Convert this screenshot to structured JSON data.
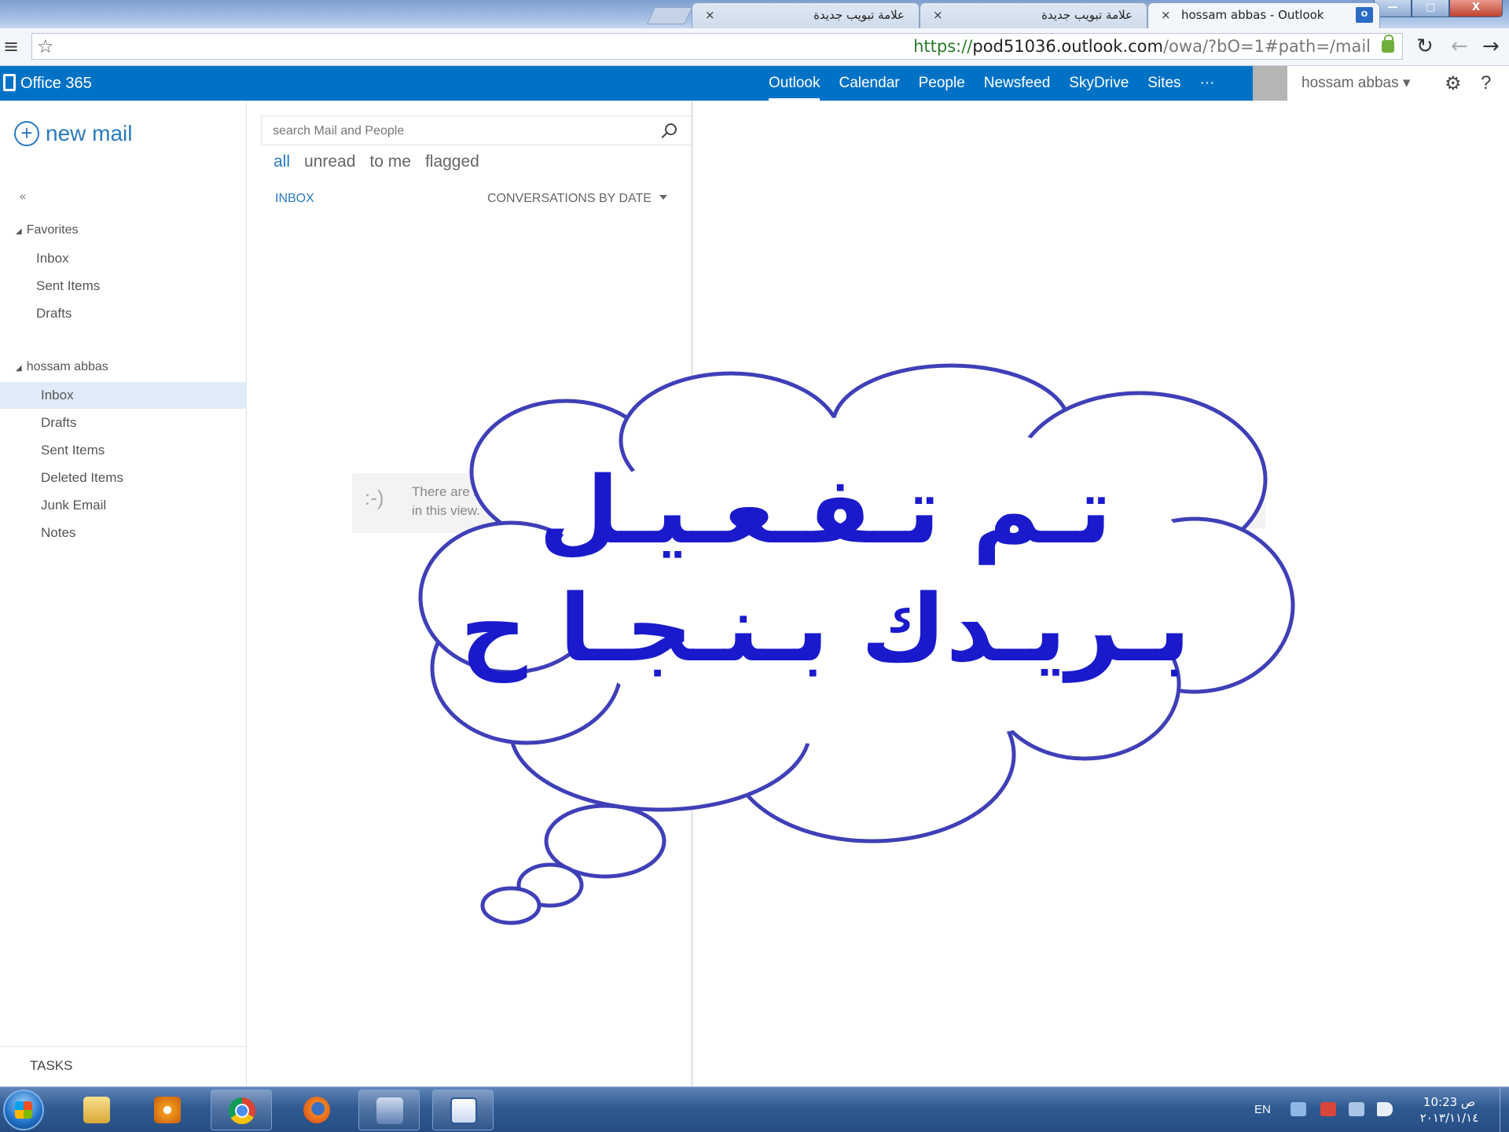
{
  "browser": {
    "tabs": [
      {
        "title": "hossam abbas - Outlook",
        "active": true
      },
      {
        "title": "علامة تبويب جديدة",
        "active": false
      },
      {
        "title": "علامة تبويب جديدة",
        "active": false
      }
    ],
    "close_glyph": "×",
    "outlook_badge": "O",
    "address": {
      "scheme": "https://",
      "host": "pod51036.outlook.com",
      "path": "/owa/?bO=1#path=/mail"
    },
    "buttons": {
      "reload": "↻",
      "back": "←",
      "forward": "→",
      "min": "—",
      "max": "□",
      "close": "X",
      "menu": "≡",
      "star": "☆"
    }
  },
  "suite": {
    "brand": "Office 365",
    "nav": [
      "Outlook",
      "Calendar",
      "People",
      "Newsfeed",
      "SkyDrive",
      "Sites",
      "···"
    ],
    "active_nav": "Outlook",
    "user": "hossam abbas ▾",
    "gear": "⚙",
    "help": "?"
  },
  "leftnav": {
    "new_mail": "new mail",
    "plus": "+",
    "collapse": "«",
    "favorites_header": "Favorites",
    "favorites": [
      "Inbox",
      "Sent Items",
      "Drafts"
    ],
    "mailbox_header": "hossam abbas",
    "mailbox": [
      "Inbox",
      "Drafts",
      "Sent Items",
      "Deleted Items",
      "Junk Email",
      "Notes"
    ],
    "selected": "Inbox",
    "tasks": "TASKS"
  },
  "msglist": {
    "search_placeholder": "search Mail and People",
    "filters": [
      "all",
      "unread",
      "to me",
      "flagged"
    ],
    "active_filter": "all",
    "folder_label": "INBOX",
    "sort_label": "CONVERSATIONS BY DATE",
    "empty_icon": ":-)",
    "empty_text": "There are no items to show in this view."
  },
  "reading": {
    "empty_text": "There are no items to show in this view."
  },
  "overlay": {
    "line1": "تـم   تـفـعـيـل",
    "line2": "بـريـدك  بـنـجـا ح",
    "color": "#1a1acc",
    "outline_color": "#3f3fb8"
  },
  "taskbar": {
    "lang": "EN",
    "clock_time": "10:23 ص",
    "clock_date": "٢٠١٣/١١/١٤"
  }
}
